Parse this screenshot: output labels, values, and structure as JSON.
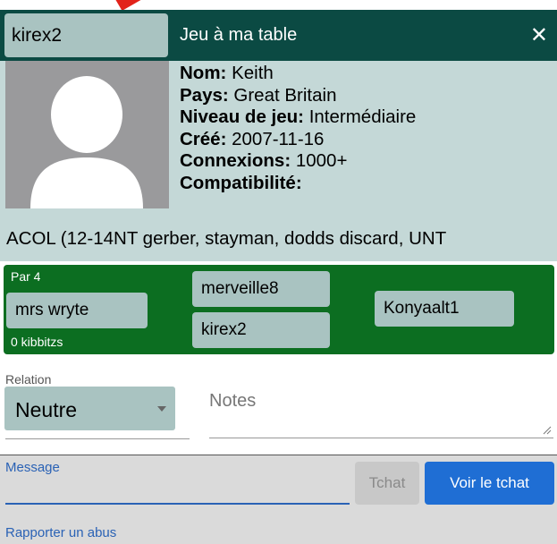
{
  "header": {
    "username": "kirex2",
    "title": "Jeu à ma table",
    "close_symbol": "✕"
  },
  "profile": {
    "name_label": "Nom:",
    "name_value": " Keith",
    "country_label": "Pays:",
    "country_value": " Great Britain",
    "level_label": "Niveau de jeu:",
    "level_value": " Intermédiaire",
    "created_label": "Créé:",
    "created_value": " 2007-11-16",
    "connections_label": "Connexions:",
    "connections_value": " 1000+",
    "compat_label": "Compatibilité:",
    "compat_value": "ACOL (12-14NT gerber, stayman, dodds discard, UNT"
  },
  "table": {
    "par_label": "Par 4",
    "kibbitz_label": "0 kibbitzs",
    "seat_west": "mrs wryte",
    "seat_north": "merveille8",
    "seat_south": "kirex2",
    "seat_east": "Konyaalt1"
  },
  "relation": {
    "label": "Relation",
    "value": "Neutre"
  },
  "notes": {
    "placeholder": "Notes"
  },
  "message": {
    "label": "Message",
    "tchat_button": "Tchat",
    "view_chat_button": "Voir le tchat",
    "report_link": "Rapporter un abus"
  },
  "colors": {
    "header_bg": "#0b4a43",
    "profile_bg": "#c4d8d7",
    "pill_bg": "#a9c3c1",
    "table_bg": "#0c6e21",
    "primary_button": "#1f6ed4",
    "link": "#2a62b5"
  }
}
